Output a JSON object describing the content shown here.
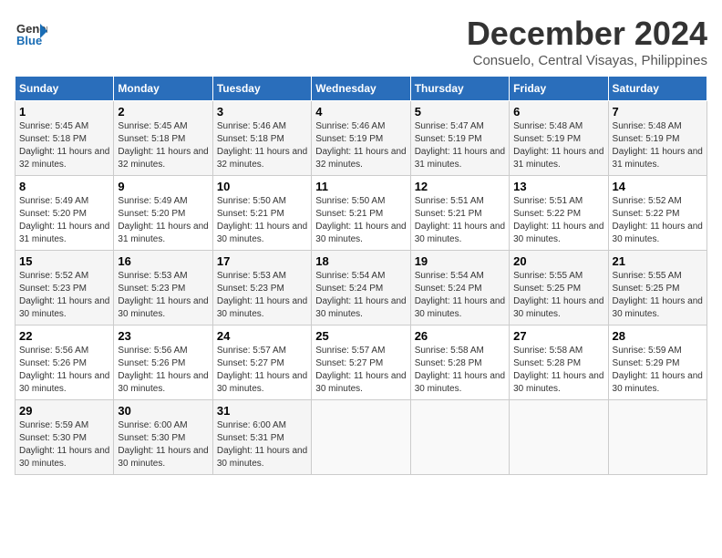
{
  "header": {
    "logo_line1": "General",
    "logo_line2": "Blue",
    "month_title": "December 2024",
    "location": "Consuelo, Central Visayas, Philippines"
  },
  "weekdays": [
    "Sunday",
    "Monday",
    "Tuesday",
    "Wednesday",
    "Thursday",
    "Friday",
    "Saturday"
  ],
  "weeks": [
    [
      {
        "day": "1",
        "sunrise": "Sunrise: 5:45 AM",
        "sunset": "Sunset: 5:18 PM",
        "daylight": "Daylight: 11 hours and 32 minutes."
      },
      {
        "day": "2",
        "sunrise": "Sunrise: 5:45 AM",
        "sunset": "Sunset: 5:18 PM",
        "daylight": "Daylight: 11 hours and 32 minutes."
      },
      {
        "day": "3",
        "sunrise": "Sunrise: 5:46 AM",
        "sunset": "Sunset: 5:18 PM",
        "daylight": "Daylight: 11 hours and 32 minutes."
      },
      {
        "day": "4",
        "sunrise": "Sunrise: 5:46 AM",
        "sunset": "Sunset: 5:19 PM",
        "daylight": "Daylight: 11 hours and 32 minutes."
      },
      {
        "day": "5",
        "sunrise": "Sunrise: 5:47 AM",
        "sunset": "Sunset: 5:19 PM",
        "daylight": "Daylight: 11 hours and 31 minutes."
      },
      {
        "day": "6",
        "sunrise": "Sunrise: 5:48 AM",
        "sunset": "Sunset: 5:19 PM",
        "daylight": "Daylight: 11 hours and 31 minutes."
      },
      {
        "day": "7",
        "sunrise": "Sunrise: 5:48 AM",
        "sunset": "Sunset: 5:19 PM",
        "daylight": "Daylight: 11 hours and 31 minutes."
      }
    ],
    [
      {
        "day": "8",
        "sunrise": "Sunrise: 5:49 AM",
        "sunset": "Sunset: 5:20 PM",
        "daylight": "Daylight: 11 hours and 31 minutes."
      },
      {
        "day": "9",
        "sunrise": "Sunrise: 5:49 AM",
        "sunset": "Sunset: 5:20 PM",
        "daylight": "Daylight: 11 hours and 31 minutes."
      },
      {
        "day": "10",
        "sunrise": "Sunrise: 5:50 AM",
        "sunset": "Sunset: 5:21 PM",
        "daylight": "Daylight: 11 hours and 30 minutes."
      },
      {
        "day": "11",
        "sunrise": "Sunrise: 5:50 AM",
        "sunset": "Sunset: 5:21 PM",
        "daylight": "Daylight: 11 hours and 30 minutes."
      },
      {
        "day": "12",
        "sunrise": "Sunrise: 5:51 AM",
        "sunset": "Sunset: 5:21 PM",
        "daylight": "Daylight: 11 hours and 30 minutes."
      },
      {
        "day": "13",
        "sunrise": "Sunrise: 5:51 AM",
        "sunset": "Sunset: 5:22 PM",
        "daylight": "Daylight: 11 hours and 30 minutes."
      },
      {
        "day": "14",
        "sunrise": "Sunrise: 5:52 AM",
        "sunset": "Sunset: 5:22 PM",
        "daylight": "Daylight: 11 hours and 30 minutes."
      }
    ],
    [
      {
        "day": "15",
        "sunrise": "Sunrise: 5:52 AM",
        "sunset": "Sunset: 5:23 PM",
        "daylight": "Daylight: 11 hours and 30 minutes."
      },
      {
        "day": "16",
        "sunrise": "Sunrise: 5:53 AM",
        "sunset": "Sunset: 5:23 PM",
        "daylight": "Daylight: 11 hours and 30 minutes."
      },
      {
        "day": "17",
        "sunrise": "Sunrise: 5:53 AM",
        "sunset": "Sunset: 5:23 PM",
        "daylight": "Daylight: 11 hours and 30 minutes."
      },
      {
        "day": "18",
        "sunrise": "Sunrise: 5:54 AM",
        "sunset": "Sunset: 5:24 PM",
        "daylight": "Daylight: 11 hours and 30 minutes."
      },
      {
        "day": "19",
        "sunrise": "Sunrise: 5:54 AM",
        "sunset": "Sunset: 5:24 PM",
        "daylight": "Daylight: 11 hours and 30 minutes."
      },
      {
        "day": "20",
        "sunrise": "Sunrise: 5:55 AM",
        "sunset": "Sunset: 5:25 PM",
        "daylight": "Daylight: 11 hours and 30 minutes."
      },
      {
        "day": "21",
        "sunrise": "Sunrise: 5:55 AM",
        "sunset": "Sunset: 5:25 PM",
        "daylight": "Daylight: 11 hours and 30 minutes."
      }
    ],
    [
      {
        "day": "22",
        "sunrise": "Sunrise: 5:56 AM",
        "sunset": "Sunset: 5:26 PM",
        "daylight": "Daylight: 11 hours and 30 minutes."
      },
      {
        "day": "23",
        "sunrise": "Sunrise: 5:56 AM",
        "sunset": "Sunset: 5:26 PM",
        "daylight": "Daylight: 11 hours and 30 minutes."
      },
      {
        "day": "24",
        "sunrise": "Sunrise: 5:57 AM",
        "sunset": "Sunset: 5:27 PM",
        "daylight": "Daylight: 11 hours and 30 minutes."
      },
      {
        "day": "25",
        "sunrise": "Sunrise: 5:57 AM",
        "sunset": "Sunset: 5:27 PM",
        "daylight": "Daylight: 11 hours and 30 minutes."
      },
      {
        "day": "26",
        "sunrise": "Sunrise: 5:58 AM",
        "sunset": "Sunset: 5:28 PM",
        "daylight": "Daylight: 11 hours and 30 minutes."
      },
      {
        "day": "27",
        "sunrise": "Sunrise: 5:58 AM",
        "sunset": "Sunset: 5:28 PM",
        "daylight": "Daylight: 11 hours and 30 minutes."
      },
      {
        "day": "28",
        "sunrise": "Sunrise: 5:59 AM",
        "sunset": "Sunset: 5:29 PM",
        "daylight": "Daylight: 11 hours and 30 minutes."
      }
    ],
    [
      {
        "day": "29",
        "sunrise": "Sunrise: 5:59 AM",
        "sunset": "Sunset: 5:30 PM",
        "daylight": "Daylight: 11 hours and 30 minutes."
      },
      {
        "day": "30",
        "sunrise": "Sunrise: 6:00 AM",
        "sunset": "Sunset: 5:30 PM",
        "daylight": "Daylight: 11 hours and 30 minutes."
      },
      {
        "day": "31",
        "sunrise": "Sunrise: 6:00 AM",
        "sunset": "Sunset: 5:31 PM",
        "daylight": "Daylight: 11 hours and 30 minutes."
      },
      null,
      null,
      null,
      null
    ]
  ]
}
